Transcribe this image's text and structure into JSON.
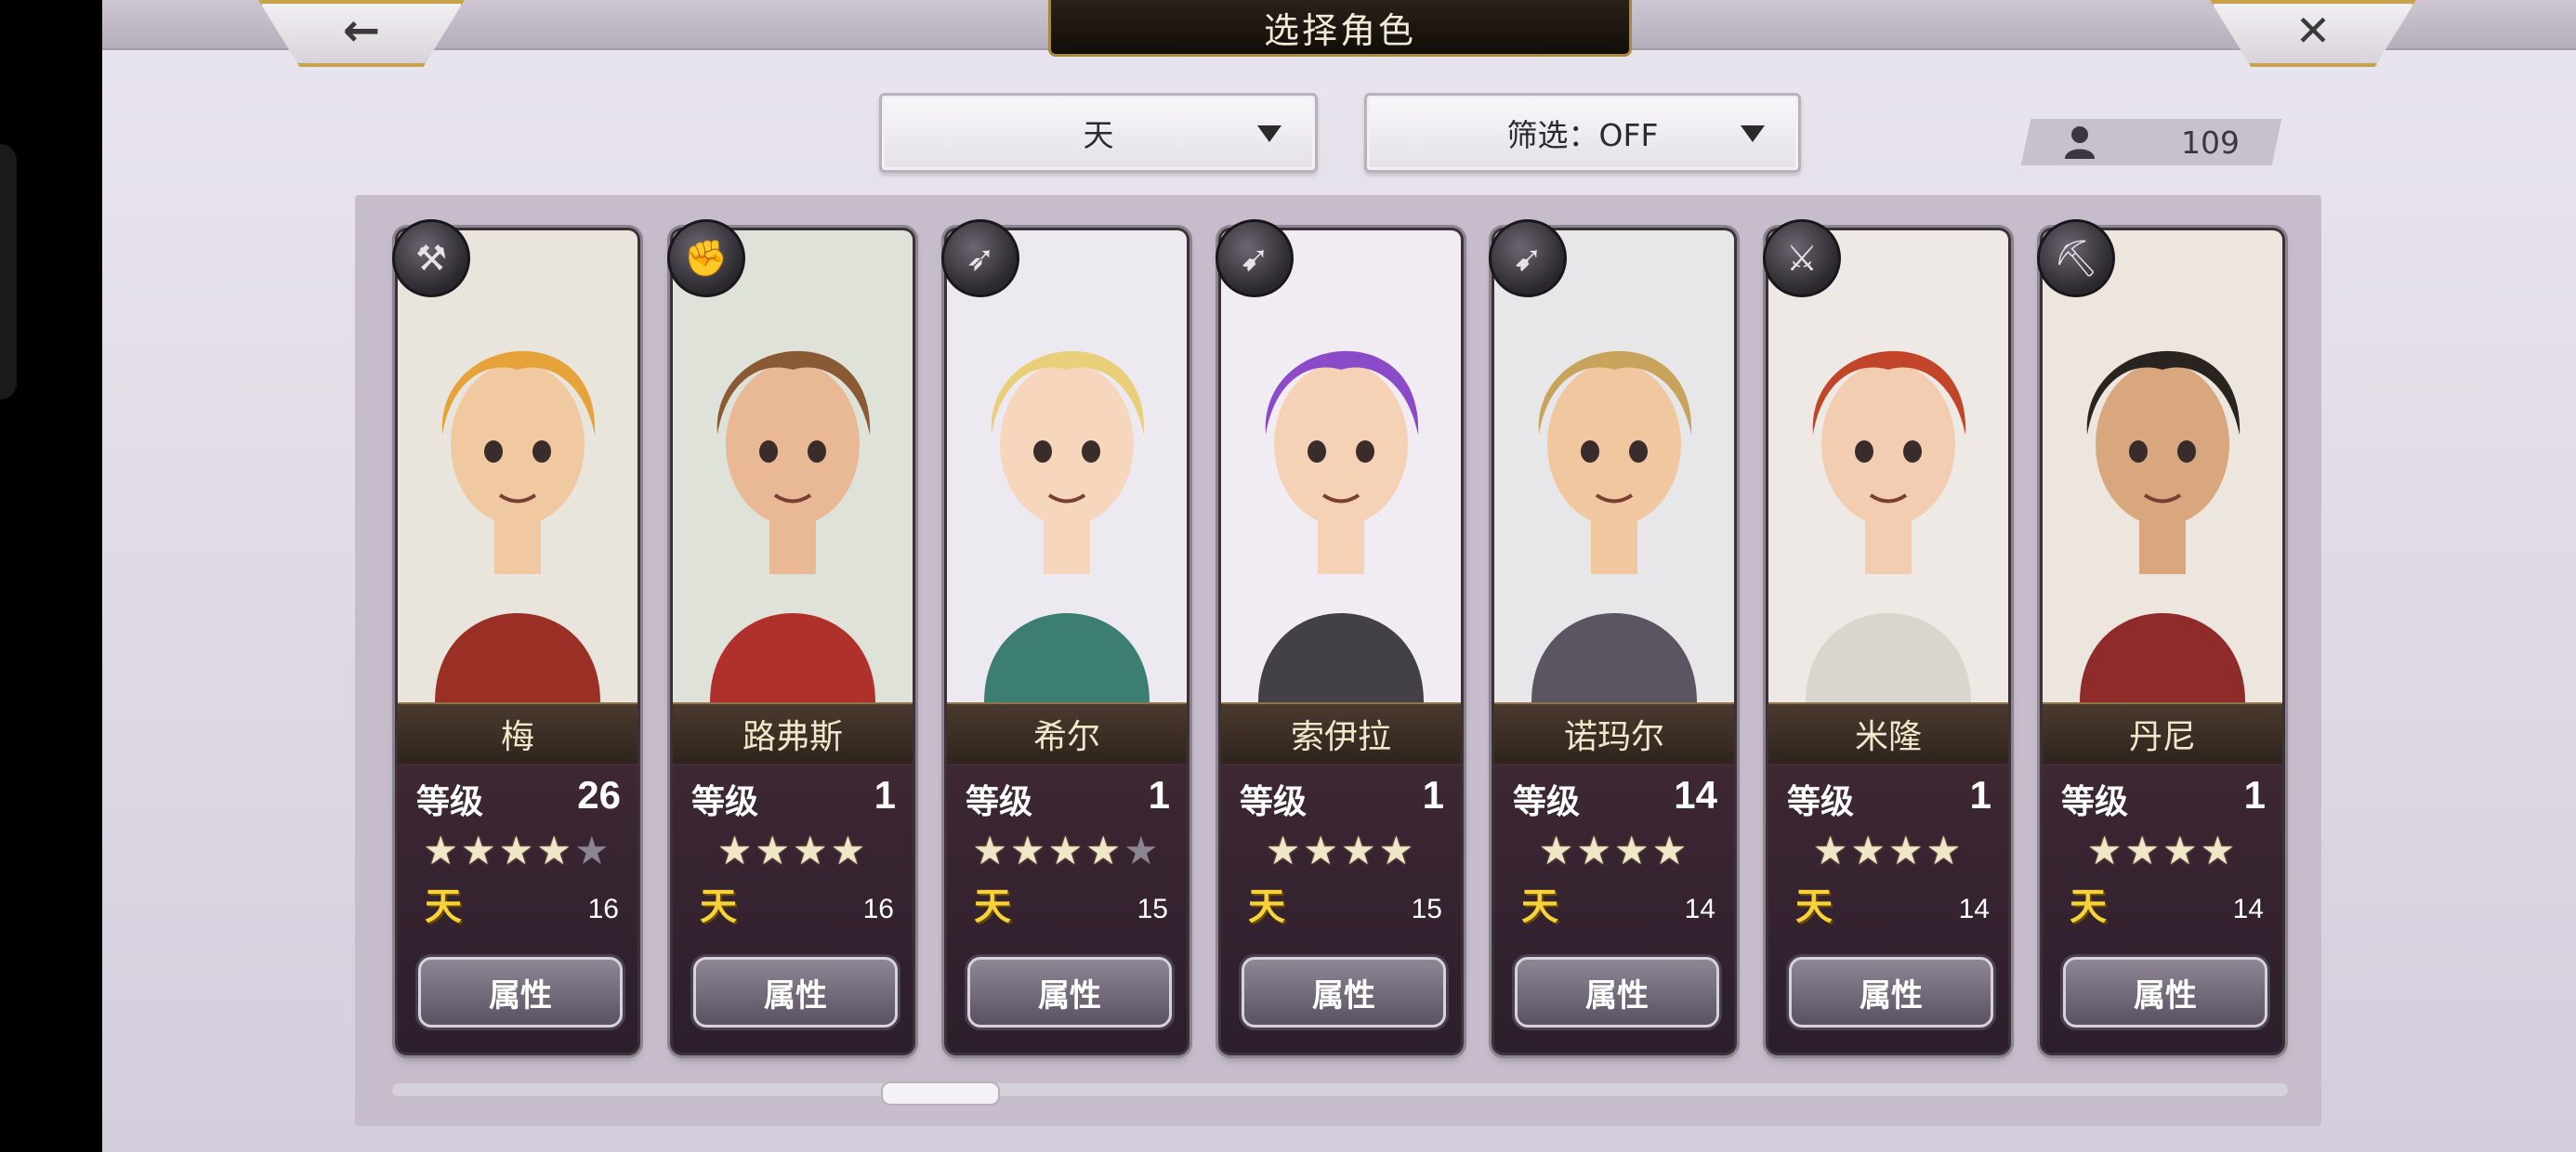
{
  "header": {
    "back_icon": "←",
    "title": "选择角色",
    "close_icon": "✕"
  },
  "filters": {
    "category": "天",
    "filter": "筛选：OFF"
  },
  "unit_count": "109",
  "characters": [
    {
      "name": "梅",
      "level_label": "等级",
      "level": "26",
      "stars_on": 4,
      "stars_total": 5,
      "rank": "天",
      "cost": "16",
      "button": "属性",
      "weapon": "hammer-icon"
    },
    {
      "name": "路弗斯",
      "level_label": "等级",
      "level": "1",
      "stars_on": 4,
      "stars_total": 4,
      "rank": "天",
      "cost": "16",
      "button": "属性",
      "weapon": "fist-icon"
    },
    {
      "name": "希尔",
      "level_label": "等级",
      "level": "1",
      "stars_on": 4,
      "stars_total": 5,
      "rank": "天",
      "cost": "15",
      "button": "属性",
      "weapon": "bow-icon"
    },
    {
      "name": "索伊拉",
      "level_label": "等级",
      "level": "1",
      "stars_on": 4,
      "stars_total": 4,
      "rank": "天",
      "cost": "15",
      "button": "属性",
      "weapon": "spear-icon"
    },
    {
      "name": "诺玛尔",
      "level_label": "等级",
      "level": "14",
      "stars_on": 4,
      "stars_total": 4,
      "rank": "天",
      "cost": "14",
      "button": "属性",
      "weapon": "spear-icon"
    },
    {
      "name": "米隆",
      "level_label": "等级",
      "level": "1",
      "stars_on": 4,
      "stars_total": 4,
      "rank": "天",
      "cost": "14",
      "button": "属性",
      "weapon": "sword-icon"
    },
    {
      "name": "丹尼",
      "level_label": "等级",
      "level": "1",
      "stars_on": 4,
      "stars_total": 4,
      "rank": "天",
      "cost": "14",
      "button": "属性",
      "weapon": "axe-icon"
    }
  ],
  "colors": {
    "gold_frame": "#c9a34c",
    "rank_yellow": "#f8d23a",
    "card_dark": "#2a1f24"
  }
}
